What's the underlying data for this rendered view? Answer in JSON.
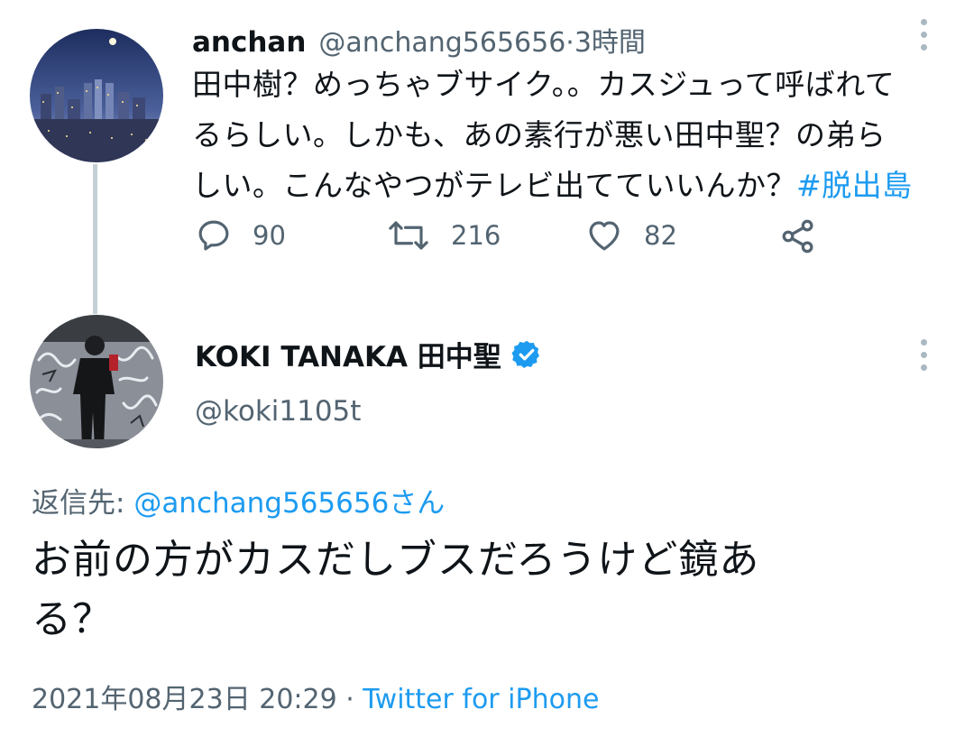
{
  "parent_tweet": {
    "display_name": "anchan",
    "handle": "@anchang565656",
    "separator": " · ",
    "time": "3時間",
    "text_lines": [
      "田中樹？めっちゃブサイク。。カスジュって呼ばれて",
      "るらしい。しかも、あの素行が悪い田中聖？の弟ら",
      "しい。こんなやつがテレビ出てていいんか？"
    ],
    "hashtag": "#脱出島",
    "reply_count": "90",
    "retweet_count": "216",
    "like_count": "82"
  },
  "main_tweet": {
    "display_name": "KOKI TANAKA 田中聖",
    "verified": true,
    "handle": "@koki1105t",
    "reply_label": "返信先: ",
    "reply_to": "@anchang565656さん",
    "text_lines": [
      "お前の方がカスだしブスだろうけど鏡あ",
      "る？"
    ],
    "date": "2021年08月23日 20:29",
    "separator": " · ",
    "source": "Twitter for iPhone"
  },
  "colors": {
    "accent": "#1d9bf0",
    "muted": "#536471",
    "thread_line": "#c4cfd6",
    "text": "#0f1419"
  }
}
